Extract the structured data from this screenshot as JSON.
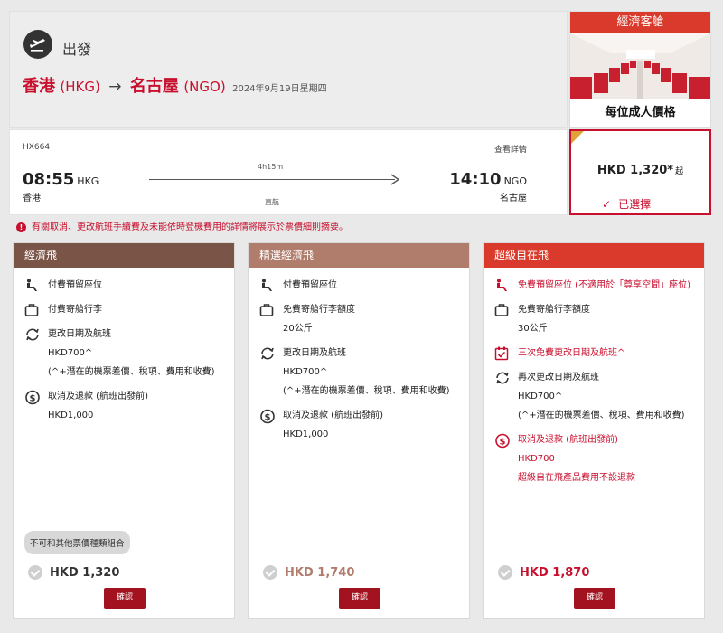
{
  "header": {
    "departure_label": "出發",
    "route": {
      "origin_city": "香港",
      "origin_code": "(HKG)",
      "arrow": "→",
      "dest_city": "名古屋",
      "dest_code": "(NGO)",
      "date": "2024年9月19日星期四"
    }
  },
  "cabin": {
    "title": "經濟客艙",
    "price_label": "每位成人價格"
  },
  "flight": {
    "number": "HX664",
    "details_link": "查看詳情",
    "dep_time": "08:55",
    "dep_code": "HKG",
    "dep_city": "香港",
    "duration": "4h15m",
    "stops": "直航",
    "arr_time": "14:10",
    "arr_code": "NGO",
    "arr_city": "名古屋"
  },
  "price": {
    "amount": "HKD 1,320*",
    "qualifier": "起",
    "selected_label": "已選擇"
  },
  "notice": "有關取消、更改航班手續費及未能依時登機費用的詳情將展示於票價細則摘要。",
  "colors": {
    "brand_red": "#c8102e",
    "fare1_header": "#7a5446",
    "fare2_header": "#b07c6c",
    "fare3_header": "#d93a2b",
    "confirm_button": "#a3121f"
  },
  "fares": [
    {
      "name": "經濟飛",
      "features": [
        {
          "icon": "seat-icon",
          "text": "付費預留座位"
        },
        {
          "icon": "baggage-icon",
          "text": "付費寄艙行李"
        },
        {
          "icon": "change-icon",
          "text": "更改日期及航班",
          "sub": [
            "HKD700^",
            "(^+潛在的機票差價、稅項、費用和收費)"
          ]
        },
        {
          "icon": "refund-icon",
          "text": "取消及退款 (航班出發前)",
          "sub": [
            "HKD1,000"
          ]
        }
      ],
      "no_combo": "不可和其他票價種類組合",
      "total": "HKD 1,320",
      "confirm": "確認"
    },
    {
      "name": "精選經濟飛",
      "features": [
        {
          "icon": "seat-icon",
          "text": "付費預留座位"
        },
        {
          "icon": "baggage-icon",
          "text": "免費寄艙行李額度",
          "sub": [
            "20公斤"
          ]
        },
        {
          "icon": "change-icon",
          "text": "更改日期及航班",
          "sub": [
            "HKD700^",
            "(^+潛在的機票差價、稅項、費用和收費)"
          ]
        },
        {
          "icon": "refund-icon",
          "text": "取消及退款 (航班出發前)",
          "sub": [
            "HKD1,000"
          ]
        }
      ],
      "total": "HKD 1,740",
      "confirm": "確認"
    },
    {
      "name": "超級自在飛",
      "features": [
        {
          "icon": "seat-icon",
          "text": "免費預留座位 (不適用於「尊享空間」座位)"
        },
        {
          "icon": "baggage-icon",
          "text": "免費寄艙行李額度",
          "sub": [
            "30公斤"
          ]
        },
        {
          "icon": "calendar-check-icon",
          "text": "三次免費更改日期及航班^"
        },
        {
          "icon": "change-icon",
          "text": "再次更改日期及航班",
          "sub": [
            "HKD700^",
            "(^+潛在的機票差價、稅項、費用和收費)"
          ]
        },
        {
          "icon": "refund-icon",
          "text": "取消及退款 (航班出發前)",
          "sub": [
            "HKD700",
            "超級自在飛產品費用不設退款"
          ]
        }
      ],
      "total": "HKD 1,870",
      "confirm": "確認"
    }
  ]
}
